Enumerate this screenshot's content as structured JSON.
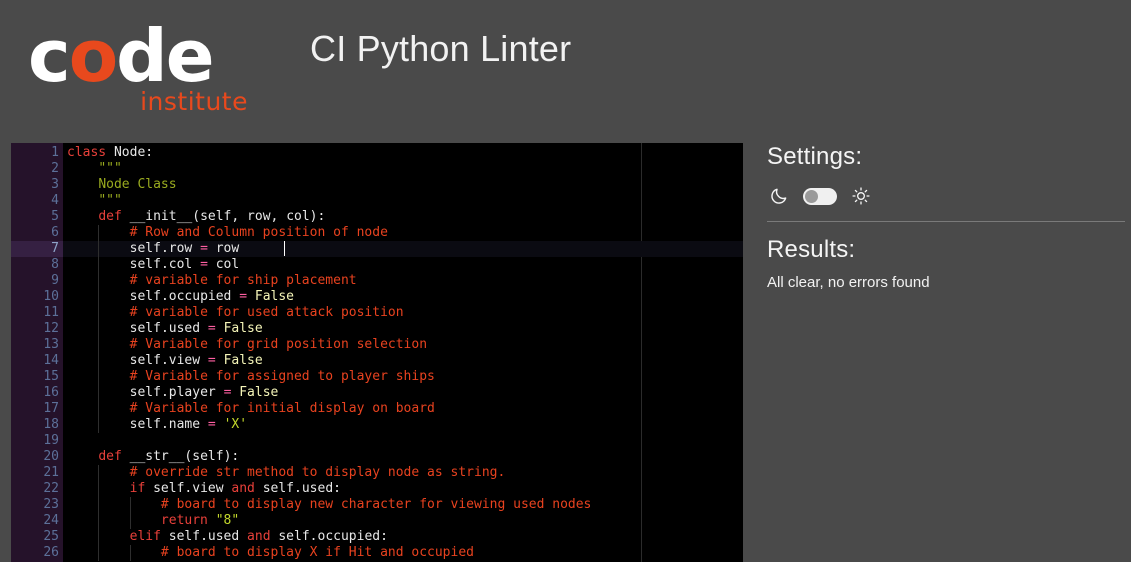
{
  "header": {
    "logo_main": "code",
    "logo_highlight_letter": "o",
    "logo_sub": "institute",
    "app_title": "CI Python Linter"
  },
  "colors": {
    "page_background": "#4a4a4a",
    "editor_background": "#000000",
    "gutter_background": "#25122a",
    "brand_orange": "#e8491d",
    "keyword": "#e8403a",
    "comment": "#e8421f",
    "string": "#c3d82c",
    "operator": "#ff5fa2",
    "identifier": "#f2f2f2",
    "constant": "#f5f5b8",
    "linenumber": "#5c7099"
  },
  "panel": {
    "settings_label": "Settings:",
    "dark_icon": "moon-icon",
    "light_icon": "sun-icon",
    "toggle_state": "off",
    "results_label": "Results:",
    "results_text": "All clear, no errors found"
  },
  "editor": {
    "active_line": 7,
    "first_visible_line": 1,
    "last_visible_line": 26,
    "ruler_column": 79,
    "lines": [
      {
        "n": 1,
        "fold": true,
        "text": "class Node:"
      },
      {
        "n": 2,
        "fold": false,
        "text": "    \"\"\""
      },
      {
        "n": 3,
        "fold": false,
        "text": "    Node Class"
      },
      {
        "n": 4,
        "fold": false,
        "text": "    \"\"\""
      },
      {
        "n": 5,
        "fold": true,
        "text": "    def __init__(self, row, col):"
      },
      {
        "n": 6,
        "fold": false,
        "text": "        # Row and Column position of node"
      },
      {
        "n": 7,
        "fold": false,
        "text": "        self.row = row"
      },
      {
        "n": 8,
        "fold": false,
        "text": "        self.col = col"
      },
      {
        "n": 9,
        "fold": false,
        "text": "        # variable for ship placement"
      },
      {
        "n": 10,
        "fold": false,
        "text": "        self.occupied = False"
      },
      {
        "n": 11,
        "fold": false,
        "text": "        # variable for used attack position"
      },
      {
        "n": 12,
        "fold": false,
        "text": "        self.used = False"
      },
      {
        "n": 13,
        "fold": false,
        "text": "        # Variable for grid position selection"
      },
      {
        "n": 14,
        "fold": false,
        "text": "        self.view = False"
      },
      {
        "n": 15,
        "fold": false,
        "text": "        # Variable for assigned to player ships"
      },
      {
        "n": 16,
        "fold": false,
        "text": "        self.player = False"
      },
      {
        "n": 17,
        "fold": false,
        "text": "        # Variable for initial display on board"
      },
      {
        "n": 18,
        "fold": false,
        "text": "        self.name = 'X'"
      },
      {
        "n": 19,
        "fold": false,
        "text": ""
      },
      {
        "n": 20,
        "fold": true,
        "text": "    def __str__(self):"
      },
      {
        "n": 21,
        "fold": false,
        "text": "        # override str method to display node as string."
      },
      {
        "n": 22,
        "fold": true,
        "text": "        if self.view and self.used:"
      },
      {
        "n": 23,
        "fold": false,
        "text": "            # board to display new character for viewing used nodes"
      },
      {
        "n": 24,
        "fold": false,
        "text": "            return \"8\""
      },
      {
        "n": 25,
        "fold": true,
        "text": "        elif self.used and self.occupied:"
      },
      {
        "n": 26,
        "fold": false,
        "text": "            # board to display X if Hit and occupied"
      }
    ]
  }
}
